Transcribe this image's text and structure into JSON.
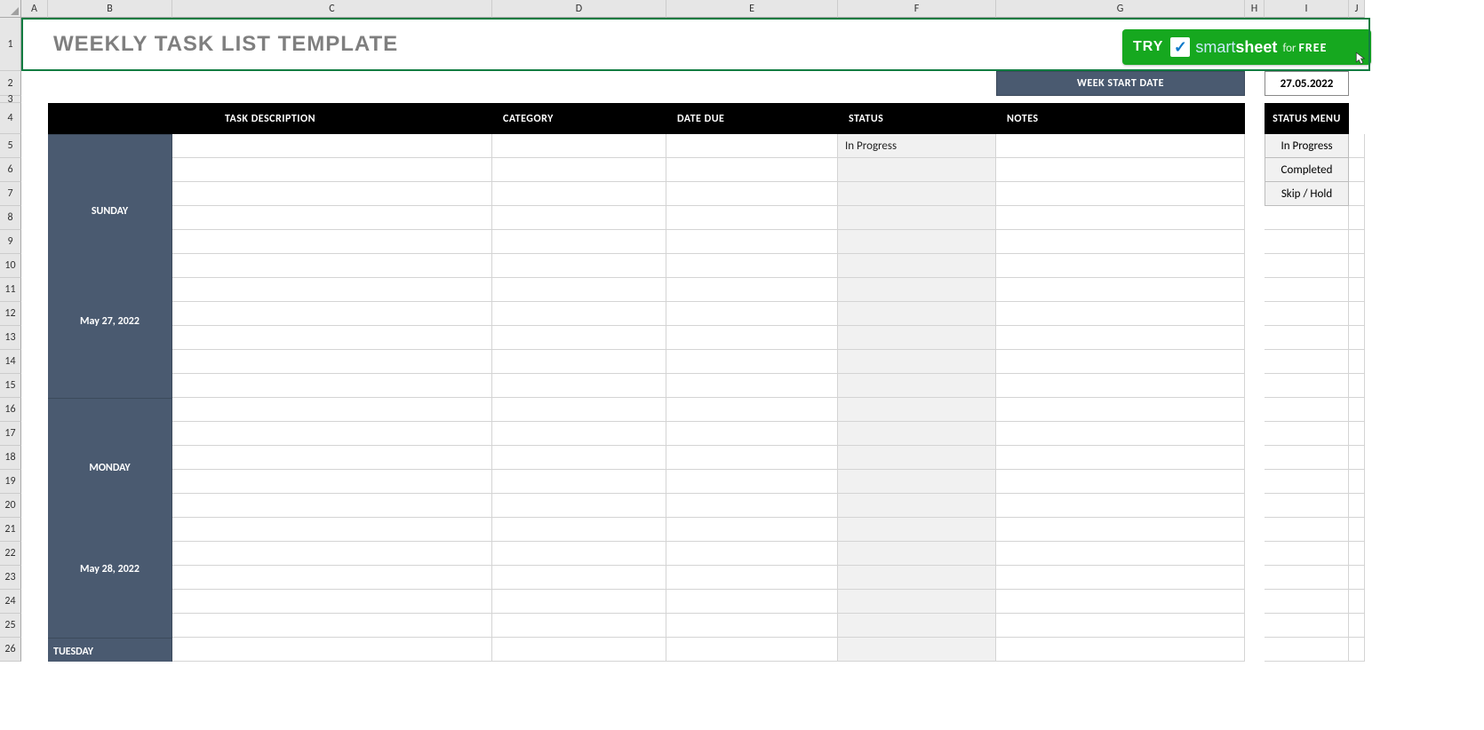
{
  "columns": [
    "A",
    "B",
    "C",
    "D",
    "E",
    "F",
    "G",
    "H",
    "I",
    "J"
  ],
  "title": "WEEKLY TASK LIST TEMPLATE",
  "try_button": {
    "try": "TRY",
    "brand_light": "smart",
    "brand_bold": "sheet",
    "for": "for",
    "free": "FREE"
  },
  "week_start_label": "WEEK START DATE",
  "week_start_value": "27.05.2022",
  "headers": {
    "task": "TASK DESCRIPTION",
    "category": "CATEGORY",
    "due": "DATE DUE",
    "status": "STATUS",
    "notes": "NOTES"
  },
  "status_menu_header": "STATUS MENU",
  "status_menu": [
    "In Progress",
    "Completed",
    "Skip / Hold"
  ],
  "days": [
    {
      "name": "SUNDAY",
      "date": "May 27, 2022",
      "rows": 11
    },
    {
      "name": "MONDAY",
      "date": "May 28, 2022",
      "rows": 10
    },
    {
      "name": "TUESDAY",
      "date": "",
      "rows": 0
    }
  ],
  "first_status_value": "In Progress",
  "row_numbers": [
    1,
    2,
    3,
    4,
    5,
    6,
    7,
    8,
    9,
    10,
    11,
    12,
    13,
    14,
    15,
    16,
    17,
    18,
    19,
    20,
    21,
    22,
    23,
    24,
    25,
    26
  ]
}
